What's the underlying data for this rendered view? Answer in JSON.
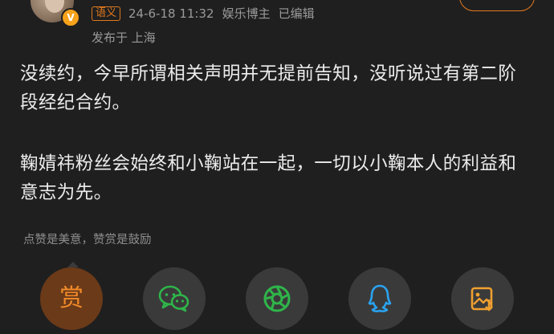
{
  "header": {
    "badge": "V",
    "source_tag": "语义",
    "timestamp": "24-6-18 11:32",
    "author_role": "娱乐博主",
    "edited": "已编辑",
    "location": "发布于 上海"
  },
  "post": {
    "paragraphs": [
      "没续约，今早所谓相关声明并无提前告知，没听说过有第二阶段经纪合约。",
      "鞠婧祎粉丝会始终和小鞠站在一起，一切以小鞠本人的利益和意志为先。"
    ]
  },
  "reward": {
    "hint": "点赞是美意，赞赏是鼓励",
    "button_label": "赏"
  },
  "share": {
    "icons": [
      "reward-icon",
      "wechat-icon",
      "moments-icon",
      "qq-icon",
      "save-image-icon"
    ]
  },
  "colors": {
    "background": "#1f1f1f",
    "accent": "#e0781e",
    "button_bg": "#3a3a3a",
    "wechat_green": "#2fb54a",
    "qq_blue": "#2aa3f0",
    "save_orange": "#f0a030"
  }
}
